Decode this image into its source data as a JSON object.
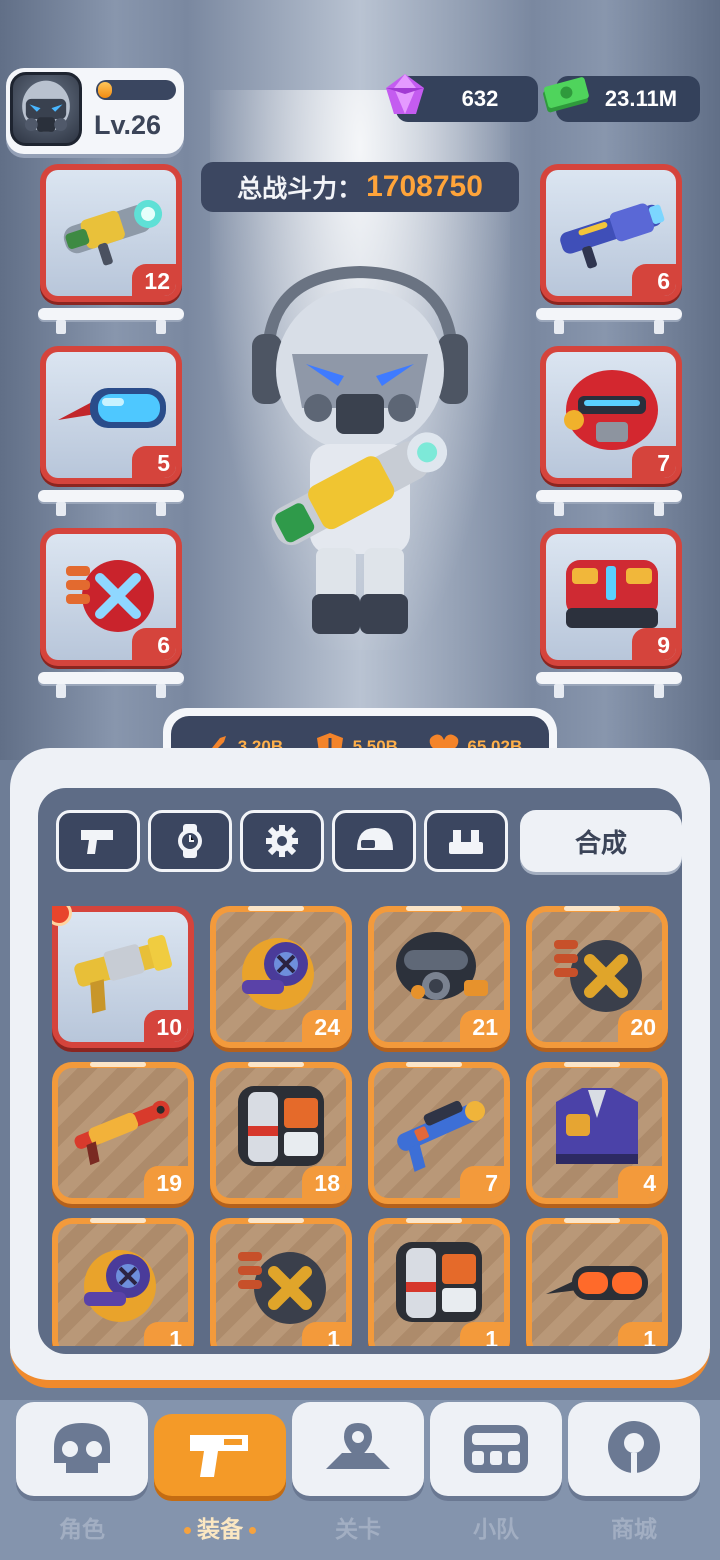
{
  "player": {
    "level": "Lv.26",
    "xp_fraction": 0.12
  },
  "currency": {
    "gems": "632",
    "cash": "23.11M"
  },
  "power": {
    "label": "总战斗力：",
    "value": "1708750"
  },
  "equip_left": [
    {
      "name": "plasma-cannon",
      "level": "12"
    },
    {
      "name": "visor-goggles",
      "level": "5"
    },
    {
      "name": "ammo-drum",
      "level": "6"
    }
  ],
  "equip_right": [
    {
      "name": "blue-rifle",
      "level": "6"
    },
    {
      "name": "red-helmet",
      "level": "7"
    },
    {
      "name": "red-armor",
      "level": "9"
    }
  ],
  "stats": {
    "attack": "3.20B",
    "defense": "5.50B",
    "health": "65.02B"
  },
  "tabs": [
    {
      "icon": "gun-icon"
    },
    {
      "icon": "watch-icon"
    },
    {
      "icon": "gear-icon"
    },
    {
      "icon": "helmet-icon"
    },
    {
      "icon": "armor-icon"
    }
  ],
  "combine_label": "合成",
  "inventory": [
    {
      "item": "golden-pistol",
      "level": "10",
      "rarity": "red",
      "new": true
    },
    {
      "item": "purple-gauntlet",
      "level": "24",
      "rarity": "orange"
    },
    {
      "item": "gas-mask",
      "level": "21",
      "rarity": "orange"
    },
    {
      "item": "ammo-drum",
      "level": "20",
      "rarity": "orange"
    },
    {
      "item": "red-shotgun",
      "level": "19",
      "rarity": "orange"
    },
    {
      "item": "mr-bone-vest",
      "level": "18",
      "rarity": "orange"
    },
    {
      "item": "blue-blaster",
      "level": "7",
      "rarity": "orange"
    },
    {
      "item": "purple-jacket",
      "level": "4",
      "rarity": "orange"
    },
    {
      "item": "purple-gauntlet",
      "level": "1",
      "rarity": "orange"
    },
    {
      "item": "ammo-drum",
      "level": "1",
      "rarity": "orange"
    },
    {
      "item": "mr-bone-vest",
      "level": "1",
      "rarity": "orange"
    },
    {
      "item": "orange-goggles",
      "level": "1",
      "rarity": "orange"
    }
  ],
  "nav": [
    {
      "label": "角色",
      "icon": "skull-icon"
    },
    {
      "label": "装备",
      "icon": "gun-icon",
      "active": true
    },
    {
      "label": "关卡",
      "icon": "map-pin-icon"
    },
    {
      "label": "小队",
      "icon": "squad-icon"
    },
    {
      "label": "商城",
      "icon": "shop-icon"
    }
  ],
  "colors": {
    "accent": "#f39a3b",
    "rare": "#d5443c",
    "panel": "#5e6c86",
    "power_value": "#ffa43a"
  }
}
